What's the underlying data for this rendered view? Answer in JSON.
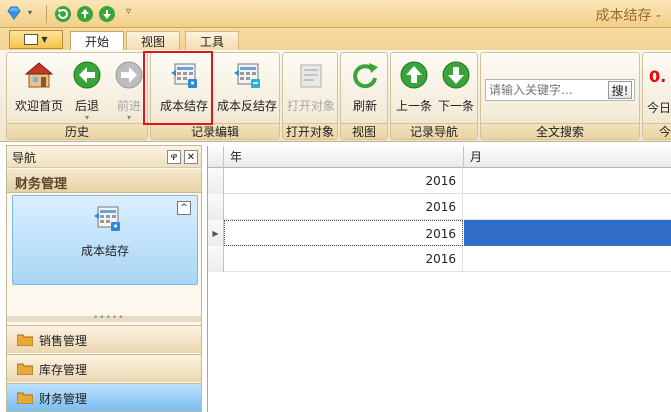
{
  "window": {
    "title": "成本结存 -"
  },
  "tabs": [
    {
      "label": "开始"
    },
    {
      "label": "视图"
    },
    {
      "label": "工具"
    }
  ],
  "ribbon": {
    "groups": {
      "history": "历史",
      "record_edit": "记录编辑",
      "open_object": "打开对象",
      "view": "视图",
      "record_nav": "记录导航",
      "fulltext_search": "全文搜索",
      "today": "今"
    },
    "buttons": {
      "welcome": "欢迎首页",
      "back": "后退",
      "forward": "前进",
      "cost_carry": "成本结存",
      "cost_reverse": "成本反结存",
      "open_object": "打开对象",
      "refresh": "刷新",
      "prev": "上一条",
      "next": "下一条"
    },
    "search": {
      "placeholder": "请输入关键字...",
      "button": "搜!"
    },
    "today": {
      "value": "0.",
      "label": "今日"
    }
  },
  "nav": {
    "title": "导航",
    "pin": "ዋ",
    "close": "✕",
    "section": "财务管理",
    "selected_item": "成本结存",
    "collapse": "^",
    "modules": [
      {
        "label": "销售管理",
        "active": false
      },
      {
        "label": "库存管理",
        "active": false
      },
      {
        "label": "财务管理",
        "active": true
      }
    ]
  },
  "grid": {
    "columns": [
      "年",
      "月"
    ],
    "rows": [
      {
        "year": "2016",
        "selected": false
      },
      {
        "year": "2016",
        "selected": false
      },
      {
        "year": "2016",
        "selected": true
      },
      {
        "year": "2016",
        "selected": false
      }
    ]
  },
  "colors": {
    "ribbon_bg": "#f2e8d2",
    "selection": "#2f6dc8",
    "highlight": "#e0161b",
    "nav_selected": "#aad5f6"
  }
}
